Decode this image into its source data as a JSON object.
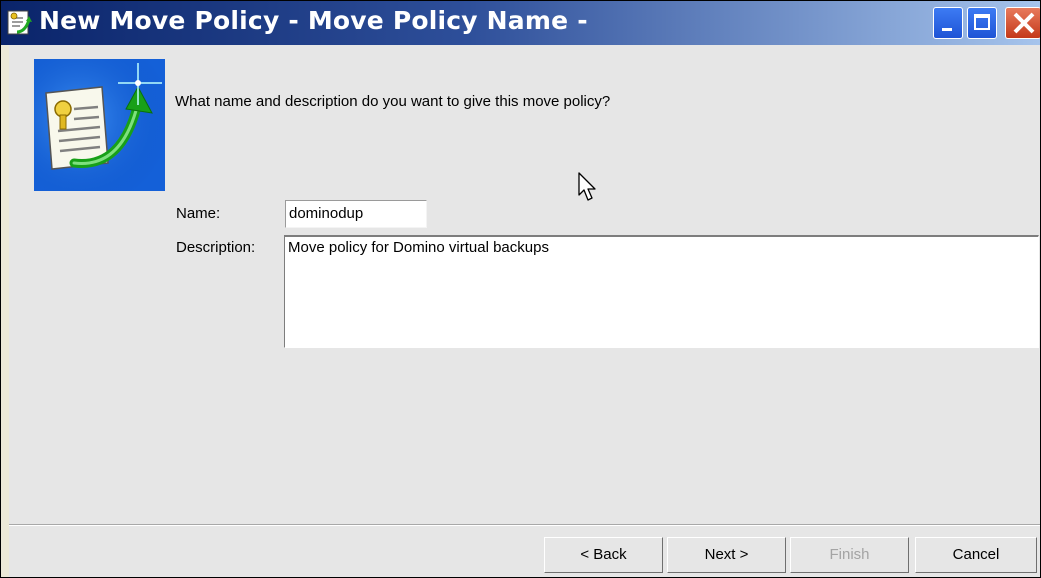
{
  "window": {
    "title": "New Move Policy - Move Policy Name -",
    "controls": [
      "minimize",
      "maximize",
      "close"
    ]
  },
  "wizard": {
    "icon": "move-policy-icon",
    "question": "What name and description do you want to give this move policy?"
  },
  "form": {
    "name_label": "Name:",
    "name_value": "dominodup",
    "description_label": "Description:",
    "description_value": "Move policy for Domino virtual backups"
  },
  "buttons": {
    "back": "< Back",
    "next": "Next >",
    "finish": "Finish",
    "cancel": "Cancel"
  },
  "colors": {
    "title_bar": "#0a246a",
    "dialog_bg": "#e6e6e6",
    "close_button": "#c4391a",
    "disabled_text": "#a4a4a4"
  }
}
